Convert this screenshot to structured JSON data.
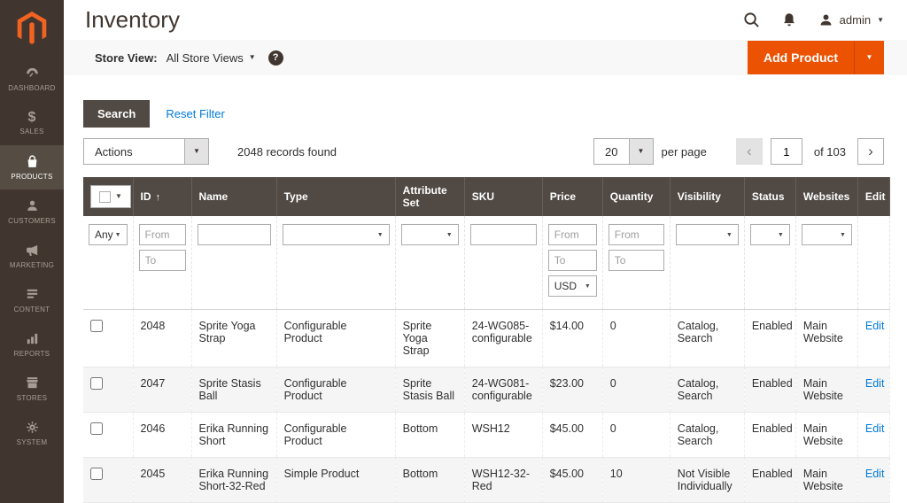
{
  "header": {
    "title": "Inventory",
    "user_label": "admin"
  },
  "sidebar": {
    "items": [
      {
        "label": "DASHBOARD"
      },
      {
        "label": "SALES"
      },
      {
        "label": "PRODUCTS"
      },
      {
        "label": "CUSTOMERS"
      },
      {
        "label": "MARKETING"
      },
      {
        "label": "CONTENT"
      },
      {
        "label": "REPORTS"
      },
      {
        "label": "STORES"
      },
      {
        "label": "SYSTEM"
      }
    ]
  },
  "store_bar": {
    "label": "Store View:",
    "value": "All Store Views",
    "help": "?",
    "add_product": "Add Product"
  },
  "controls": {
    "search": "Search",
    "reset": "Reset Filter",
    "actions": "Actions",
    "records": "2048 records found",
    "per_page": "20",
    "per_page_label": "per page",
    "page": "1",
    "page_of": "of 103"
  },
  "table": {
    "columns": [
      "ID",
      "Name",
      "Type",
      "Attribute Set",
      "SKU",
      "Price",
      "Quantity",
      "Visibility",
      "Status",
      "Websites",
      "Edit"
    ],
    "filter": {
      "any": "Any",
      "from_placeholder": "From",
      "to_placeholder": "To",
      "currency": "USD"
    },
    "rows": [
      {
        "id": "2048",
        "name": "Sprite Yoga Strap",
        "type": "Configurable Product",
        "attribute_set": "Sprite Yoga Strap",
        "sku": "24-WG085-configurable",
        "price": "$14.00",
        "quantity": "0",
        "visibility": "Catalog, Search",
        "status": "Enabled",
        "websites": "Main Website",
        "edit": "Edit"
      },
      {
        "id": "2047",
        "name": "Sprite Stasis Ball",
        "type": "Configurable Product",
        "attribute_set": "Sprite Stasis Ball",
        "sku": "24-WG081-configurable",
        "price": "$23.00",
        "quantity": "0",
        "visibility": "Catalog, Search",
        "status": "Enabled",
        "websites": "Main Website",
        "edit": "Edit"
      },
      {
        "id": "2046",
        "name": "Erika Running Short",
        "type": "Configurable Product",
        "attribute_set": "Bottom",
        "sku": "WSH12",
        "price": "$45.00",
        "quantity": "0",
        "visibility": "Catalog, Search",
        "status": "Enabled",
        "websites": "Main Website",
        "edit": "Edit"
      },
      {
        "id": "2045",
        "name": "Erika Running Short-32-Red",
        "type": "Simple Product",
        "attribute_set": "Bottom",
        "sku": "WSH12-32-Red",
        "price": "$45.00",
        "quantity": "10",
        "visibility": "Not Visible Individually",
        "status": "Enabled",
        "websites": "Main Website",
        "edit": "Edit"
      }
    ]
  },
  "colors": {
    "accent_orange": "#eb5202",
    "grid_header": "#514943",
    "sidebar_bg": "#41362f",
    "link_blue": "#007bdb",
    "row_alt": "#f5f5f5"
  }
}
